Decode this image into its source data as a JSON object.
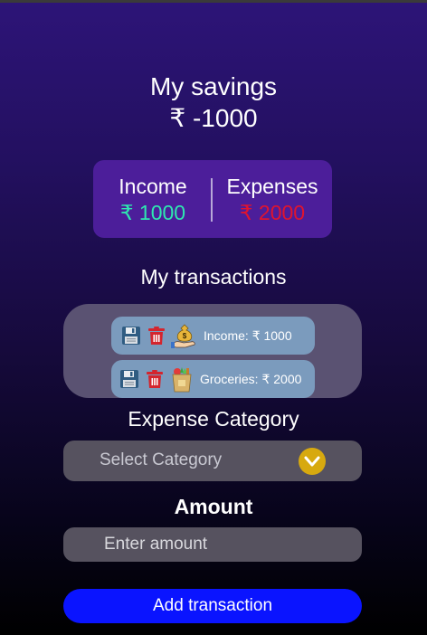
{
  "header": {
    "title": "My savings",
    "balance": "₹ -1000"
  },
  "summary": {
    "income_label": "Income",
    "income_value": "₹ 1000",
    "expenses_label": "Expenses",
    "expenses_value": "₹ 2000"
  },
  "transactions": {
    "title": "My transactions",
    "items": [
      {
        "label": "Income: ₹ 1000",
        "icon": "money-bag-hand-icon"
      },
      {
        "label": "Groceries: ₹ 2000",
        "icon": "grocery-bag-icon"
      }
    ]
  },
  "form": {
    "category_title": "Expense Category",
    "category_placeholder": "Select Category",
    "amount_title": "Amount",
    "amount_placeholder": "Enter amount",
    "submit_label": "Add transaction"
  },
  "colors": {
    "income": "#2ee8b0",
    "expense": "#e0142e",
    "button": "#0a14ff",
    "chevron": "#d7a90f"
  }
}
